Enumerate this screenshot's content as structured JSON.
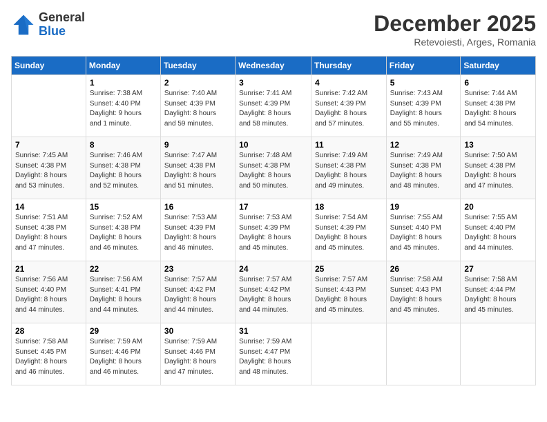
{
  "header": {
    "logo": {
      "general": "General",
      "blue": "Blue"
    },
    "title": "December 2025",
    "subtitle": "Retevoiesti, Arges, Romania"
  },
  "weekdays": [
    "Sunday",
    "Monday",
    "Tuesday",
    "Wednesday",
    "Thursday",
    "Friday",
    "Saturday"
  ],
  "weeks": [
    [
      {
        "day": "",
        "info": ""
      },
      {
        "day": "1",
        "info": "Sunrise: 7:38 AM\nSunset: 4:40 PM\nDaylight: 9 hours\nand 1 minute."
      },
      {
        "day": "2",
        "info": "Sunrise: 7:40 AM\nSunset: 4:39 PM\nDaylight: 8 hours\nand 59 minutes."
      },
      {
        "day": "3",
        "info": "Sunrise: 7:41 AM\nSunset: 4:39 PM\nDaylight: 8 hours\nand 58 minutes."
      },
      {
        "day": "4",
        "info": "Sunrise: 7:42 AM\nSunset: 4:39 PM\nDaylight: 8 hours\nand 57 minutes."
      },
      {
        "day": "5",
        "info": "Sunrise: 7:43 AM\nSunset: 4:39 PM\nDaylight: 8 hours\nand 55 minutes."
      },
      {
        "day": "6",
        "info": "Sunrise: 7:44 AM\nSunset: 4:38 PM\nDaylight: 8 hours\nand 54 minutes."
      }
    ],
    [
      {
        "day": "7",
        "info": "Sunrise: 7:45 AM\nSunset: 4:38 PM\nDaylight: 8 hours\nand 53 minutes."
      },
      {
        "day": "8",
        "info": "Sunrise: 7:46 AM\nSunset: 4:38 PM\nDaylight: 8 hours\nand 52 minutes."
      },
      {
        "day": "9",
        "info": "Sunrise: 7:47 AM\nSunset: 4:38 PM\nDaylight: 8 hours\nand 51 minutes."
      },
      {
        "day": "10",
        "info": "Sunrise: 7:48 AM\nSunset: 4:38 PM\nDaylight: 8 hours\nand 50 minutes."
      },
      {
        "day": "11",
        "info": "Sunrise: 7:49 AM\nSunset: 4:38 PM\nDaylight: 8 hours\nand 49 minutes."
      },
      {
        "day": "12",
        "info": "Sunrise: 7:49 AM\nSunset: 4:38 PM\nDaylight: 8 hours\nand 48 minutes."
      },
      {
        "day": "13",
        "info": "Sunrise: 7:50 AM\nSunset: 4:38 PM\nDaylight: 8 hours\nand 47 minutes."
      }
    ],
    [
      {
        "day": "14",
        "info": "Sunrise: 7:51 AM\nSunset: 4:38 PM\nDaylight: 8 hours\nand 47 minutes."
      },
      {
        "day": "15",
        "info": "Sunrise: 7:52 AM\nSunset: 4:38 PM\nDaylight: 8 hours\nand 46 minutes."
      },
      {
        "day": "16",
        "info": "Sunrise: 7:53 AM\nSunset: 4:39 PM\nDaylight: 8 hours\nand 46 minutes."
      },
      {
        "day": "17",
        "info": "Sunrise: 7:53 AM\nSunset: 4:39 PM\nDaylight: 8 hours\nand 45 minutes."
      },
      {
        "day": "18",
        "info": "Sunrise: 7:54 AM\nSunset: 4:39 PM\nDaylight: 8 hours\nand 45 minutes."
      },
      {
        "day": "19",
        "info": "Sunrise: 7:55 AM\nSunset: 4:40 PM\nDaylight: 8 hours\nand 45 minutes."
      },
      {
        "day": "20",
        "info": "Sunrise: 7:55 AM\nSunset: 4:40 PM\nDaylight: 8 hours\nand 44 minutes."
      }
    ],
    [
      {
        "day": "21",
        "info": "Sunrise: 7:56 AM\nSunset: 4:40 PM\nDaylight: 8 hours\nand 44 minutes."
      },
      {
        "day": "22",
        "info": "Sunrise: 7:56 AM\nSunset: 4:41 PM\nDaylight: 8 hours\nand 44 minutes."
      },
      {
        "day": "23",
        "info": "Sunrise: 7:57 AM\nSunset: 4:42 PM\nDaylight: 8 hours\nand 44 minutes."
      },
      {
        "day": "24",
        "info": "Sunrise: 7:57 AM\nSunset: 4:42 PM\nDaylight: 8 hours\nand 44 minutes."
      },
      {
        "day": "25",
        "info": "Sunrise: 7:57 AM\nSunset: 4:43 PM\nDaylight: 8 hours\nand 45 minutes."
      },
      {
        "day": "26",
        "info": "Sunrise: 7:58 AM\nSunset: 4:43 PM\nDaylight: 8 hours\nand 45 minutes."
      },
      {
        "day": "27",
        "info": "Sunrise: 7:58 AM\nSunset: 4:44 PM\nDaylight: 8 hours\nand 45 minutes."
      }
    ],
    [
      {
        "day": "28",
        "info": "Sunrise: 7:58 AM\nSunset: 4:45 PM\nDaylight: 8 hours\nand 46 minutes."
      },
      {
        "day": "29",
        "info": "Sunrise: 7:59 AM\nSunset: 4:46 PM\nDaylight: 8 hours\nand 46 minutes."
      },
      {
        "day": "30",
        "info": "Sunrise: 7:59 AM\nSunset: 4:46 PM\nDaylight: 8 hours\nand 47 minutes."
      },
      {
        "day": "31",
        "info": "Sunrise: 7:59 AM\nSunset: 4:47 PM\nDaylight: 8 hours\nand 48 minutes."
      },
      {
        "day": "",
        "info": ""
      },
      {
        "day": "",
        "info": ""
      },
      {
        "day": "",
        "info": ""
      }
    ]
  ]
}
